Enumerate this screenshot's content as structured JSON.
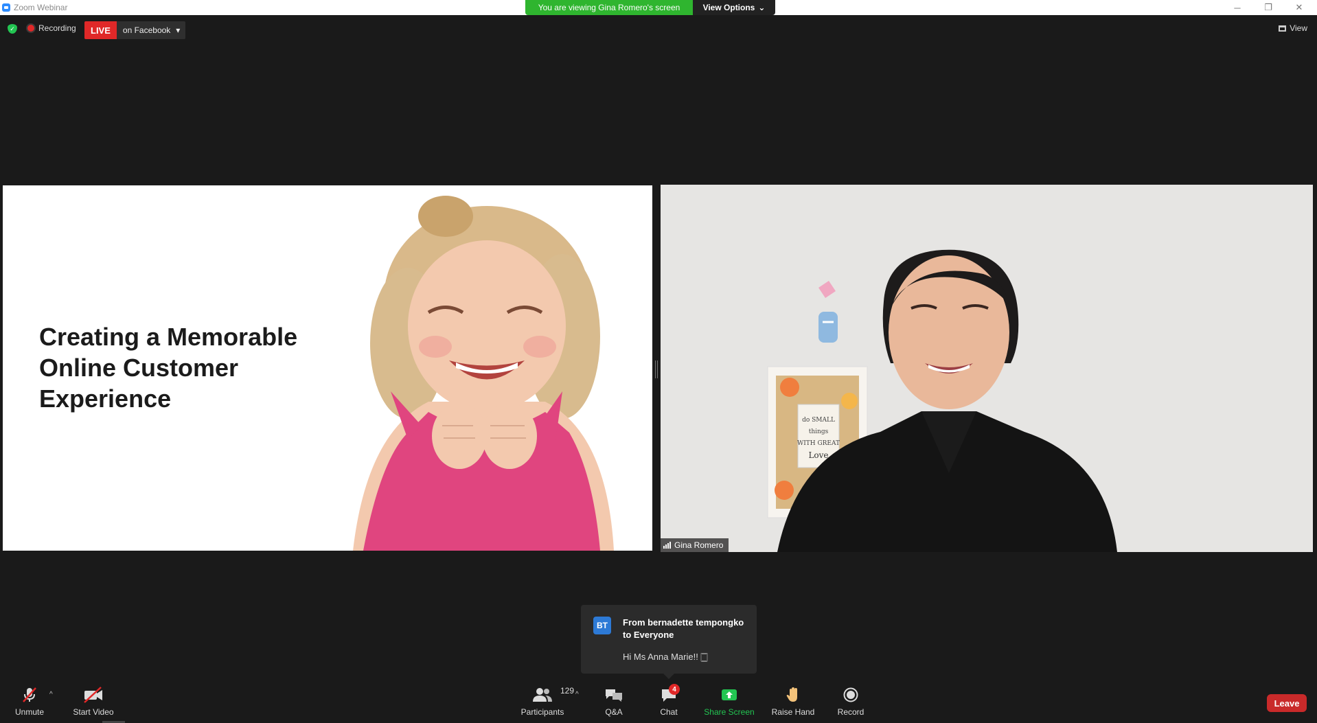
{
  "window": {
    "title": "Zoom Webinar",
    "controls": [
      "─",
      "❐",
      "✕"
    ]
  },
  "banner": {
    "viewing_text": "You are viewing Gina Romero's screen",
    "view_options_label": "View Options",
    "view_options_caret": "⌄"
  },
  "top_bar": {
    "recording_label": "Recording",
    "live_label": "LIVE",
    "live_target": "on Facebook",
    "live_caret": "▾",
    "view_label": "View"
  },
  "shared_screen": {
    "slide_title": "Creating a Memorable Online Customer Experience"
  },
  "video": {
    "participant_name": "Gina Romero",
    "sign_lines": [
      "do SMALL",
      "things",
      "WITH GREAT",
      "Love"
    ]
  },
  "chat_popup": {
    "avatar_initials": "BT",
    "from_line": "From bernadette tempongko to Everyone",
    "message": "Hi Ms Anna Marie!! 🀆"
  },
  "toolbar": {
    "unmute_label": "Unmute",
    "start_video_label": "Start Video",
    "participants_label": "Participants",
    "participants_count": "129",
    "qa_label": "Q&A",
    "chat_label": "Chat",
    "chat_badge": "4",
    "share_screen_label": "Share Screen",
    "raise_hand_label": "Raise Hand",
    "record_label": "Record",
    "leave_label": "Leave",
    "caret": "^"
  },
  "colors": {
    "accent_green": "#23c552",
    "live_red": "#e02828",
    "leave_red": "#c92a2a",
    "background": "#1a1a1a"
  }
}
